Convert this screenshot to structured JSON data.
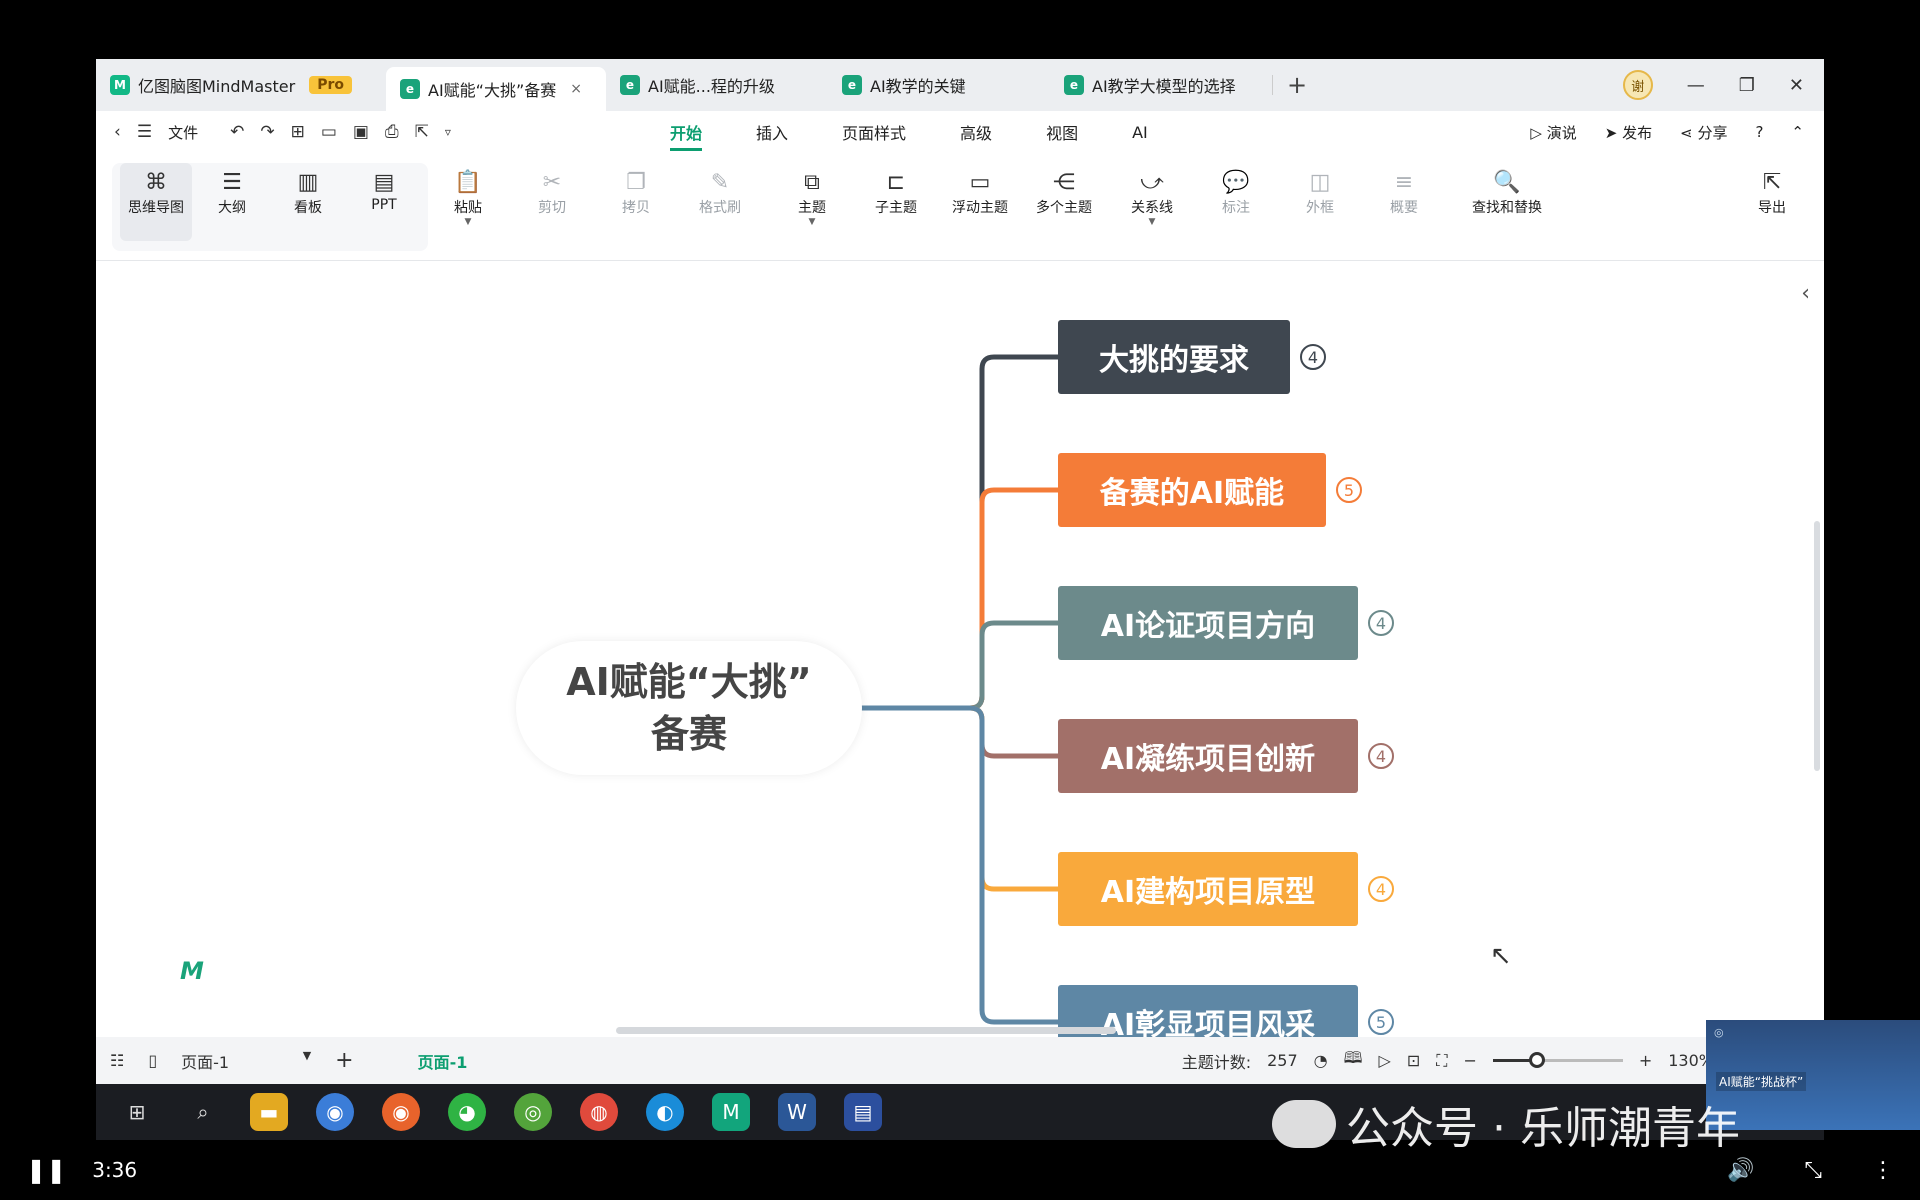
{
  "tabs": [
    {
      "label": "亿图脑图MindMaster",
      "badge": "Pro"
    },
    {
      "label": "AI赋能“大挑”备赛",
      "close": "×"
    },
    {
      "label": "AI赋能...程的升级"
    },
    {
      "label": "AI教学的关键"
    },
    {
      "label": "AI教学大模型的选择"
    }
  ],
  "tab_add": "+",
  "user_avatar": "谢",
  "menu": {
    "file": "文件",
    "tabs": [
      "开始",
      "插入",
      "页面样式",
      "高级",
      "视图",
      "AI"
    ],
    "present": "演说",
    "publish": "发布",
    "share": "分享"
  },
  "ribbon": {
    "views": [
      "思维导图",
      "大纲",
      "看板",
      "PPT"
    ],
    "tools": [
      {
        "label": "粘贴",
        "enabled": true
      },
      {
        "label": "剪切",
        "enabled": false
      },
      {
        "label": "拷贝",
        "enabled": false
      },
      {
        "label": "格式刷",
        "enabled": false
      },
      {
        "label": "主题",
        "enabled": true
      },
      {
        "label": "子主题",
        "enabled": true
      },
      {
        "label": "浮动主题",
        "enabled": true
      },
      {
        "label": "多个主题",
        "enabled": true
      },
      {
        "label": "关系线",
        "enabled": true
      },
      {
        "label": "标注",
        "enabled": false
      },
      {
        "label": "外框",
        "enabled": false
      },
      {
        "label": "概要",
        "enabled": false
      },
      {
        "label": "查找和替换",
        "enabled": true
      },
      {
        "label": "导出",
        "enabled": true
      }
    ]
  },
  "mindmap": {
    "central_line1": "AI赋能“大挑”",
    "central_line2": "备赛",
    "nodes": [
      {
        "label": "大挑的要求",
        "count": "4",
        "color": "#3f4750",
        "line": "#3f4750"
      },
      {
        "label": "备赛的AI赋能",
        "count": "5",
        "color": "#f47c38",
        "line": "#f47c38"
      },
      {
        "label": "AI论证项目方向",
        "count": "4",
        "color": "#6c8a8b",
        "line": "#6c8a8b"
      },
      {
        "label": "AI凝练项目创新",
        "count": "4",
        "color": "#a27069",
        "line": "#a27069"
      },
      {
        "label": "AI建构项目原型",
        "count": "4",
        "color": "#f9a93c",
        "line": "#f9a93c"
      },
      {
        "label": "AI彰显项目风采",
        "count": "5",
        "color": "#5e87a5",
        "line": "#5e87a5"
      }
    ]
  },
  "status": {
    "page_select": "页面-1",
    "page_add": "+",
    "page_tab": "页面-1",
    "topic_count_label": "主题计数:",
    "topic_count": "257",
    "zoom": "130%",
    "zoom_minus": "−",
    "zoom_plus": "+"
  },
  "overlay": {
    "watermark": "公众号 · 乐师潮青年",
    "pip_label": "AI赋能“挑战杯”",
    "time": "3:36"
  }
}
